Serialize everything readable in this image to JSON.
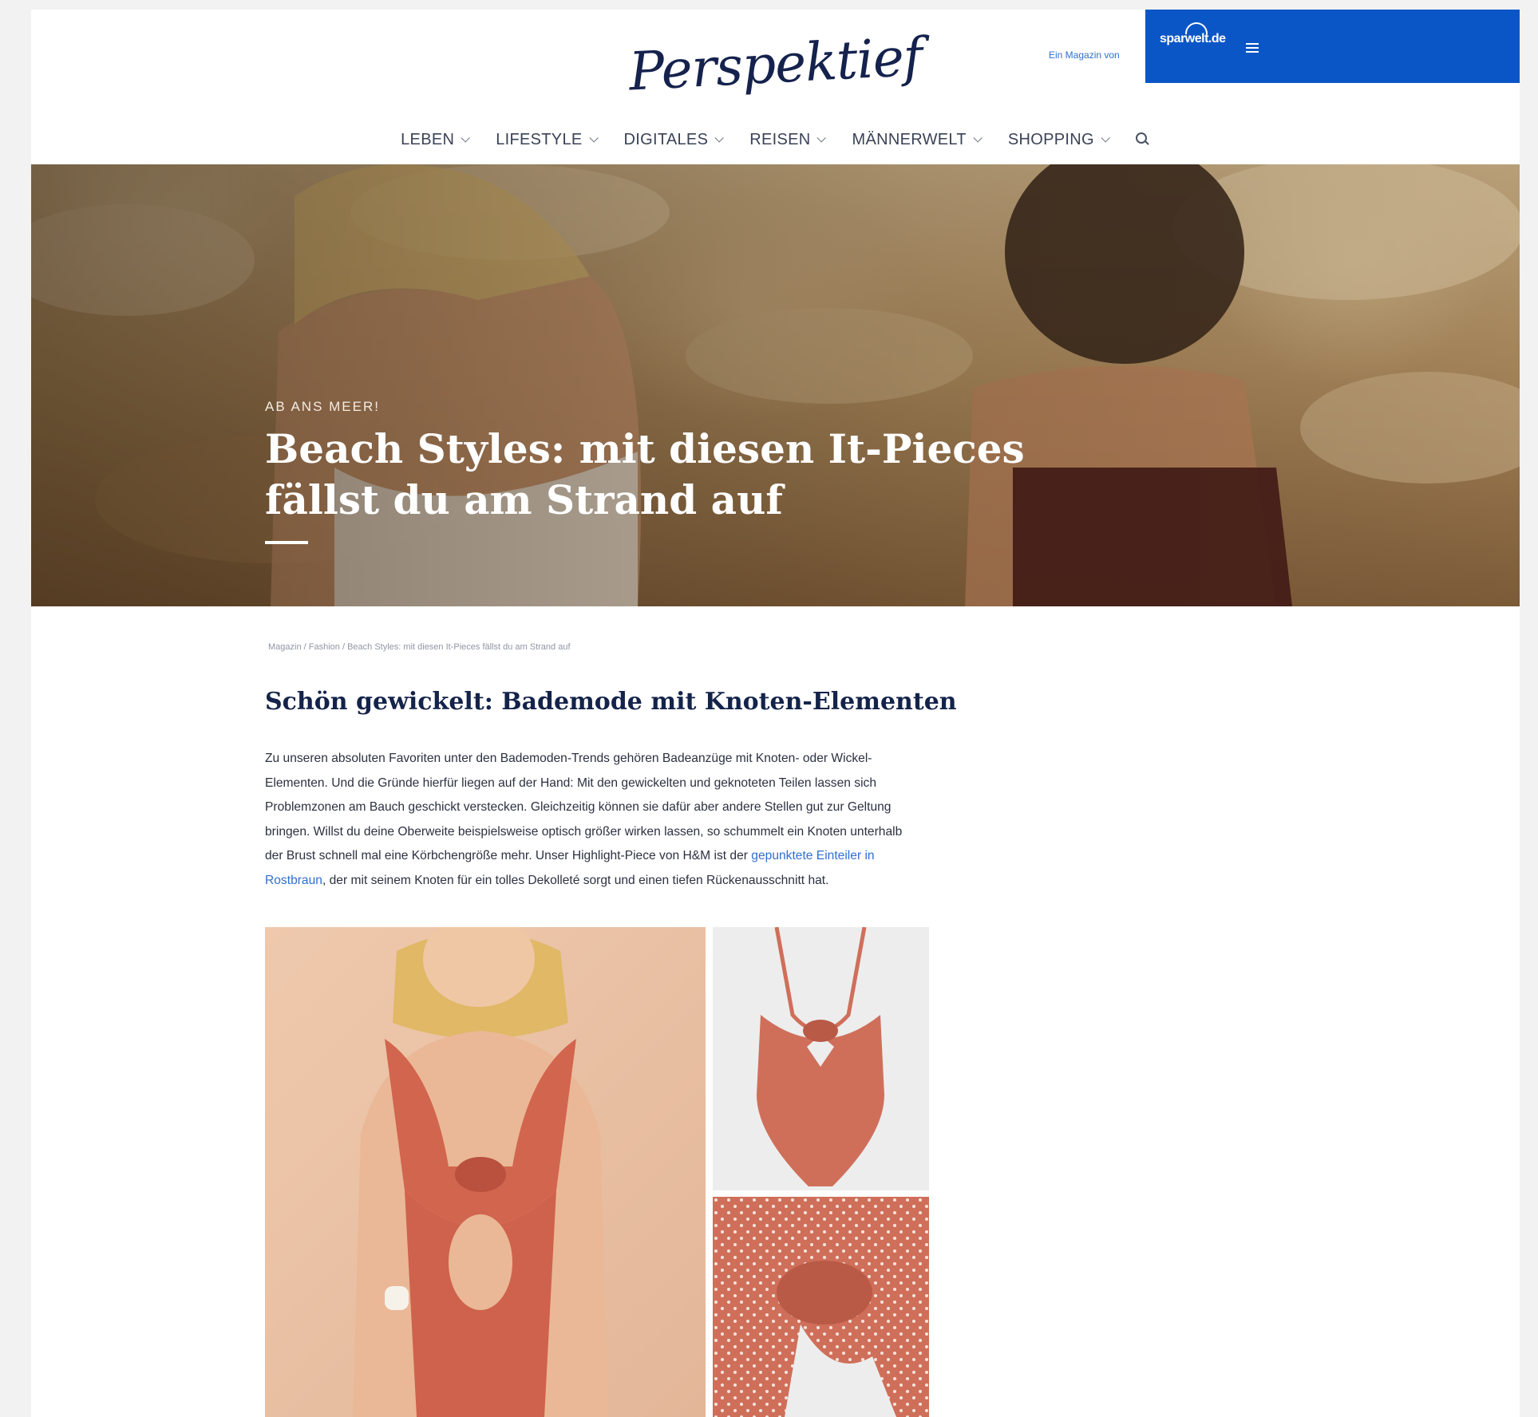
{
  "header": {
    "logo": "Perspektief",
    "partner_text": "Ein Magazin von",
    "brand": "sparwelt.de"
  },
  "nav": {
    "items": [
      "LEBEN",
      "LIFESTYLE",
      "DIGITALES",
      "REISEN",
      "MÄNNERWELT",
      "SHOPPING"
    ]
  },
  "hero": {
    "kicker": "AB ANS MEER!",
    "title": "Beach Styles: mit diesen It-Pieces fällst du am Strand auf"
  },
  "breadcrumb": {
    "items": [
      "Magazin",
      "Fashion",
      "Beach Styles: mit diesen It-Pieces fällst du am Strand auf"
    ],
    "separator": "/"
  },
  "article": {
    "heading": "Schön gewickelt: Bademode mit Knoten-Elementen",
    "body_before_link": "Zu unseren absoluten Favoriten unter den Bademoden-Trends gehören Badeanzüge mit Knoten- oder Wickel-Elementen. Und die Gründe hierfür liegen auf der Hand: Mit den gewickelten und geknoteten Teilen lassen sich Problemzonen am Bauch geschickt verstecken. Gleichzeitig können sie dafür aber andere Stellen gut zur Geltung bringen. Willst du deine Oberweite beispielsweise optisch größer wirken lassen, so schummelt ein Knoten unterhalb der Brust schnell mal eine Körbchengröße mehr. Unser Highlight-Piece von H&M ist der ",
    "link_text": "gepunktete Einteiler in Rostbraun",
    "body_after_link": ", der mit seinem Knoten für ein tolles Dekolleté sorgt und einen tiefen Rückenausschnitt hat."
  },
  "colors": {
    "brand_blue": "#0b56c6",
    "heading_navy": "#14234a",
    "link_blue": "#2f6fd0",
    "swimsuit_rust": "#cf6f5a"
  },
  "icons": {
    "nav_dropdown": "chevron-down-icon",
    "search": "search-icon",
    "menu": "hamburger-menu-icon"
  }
}
